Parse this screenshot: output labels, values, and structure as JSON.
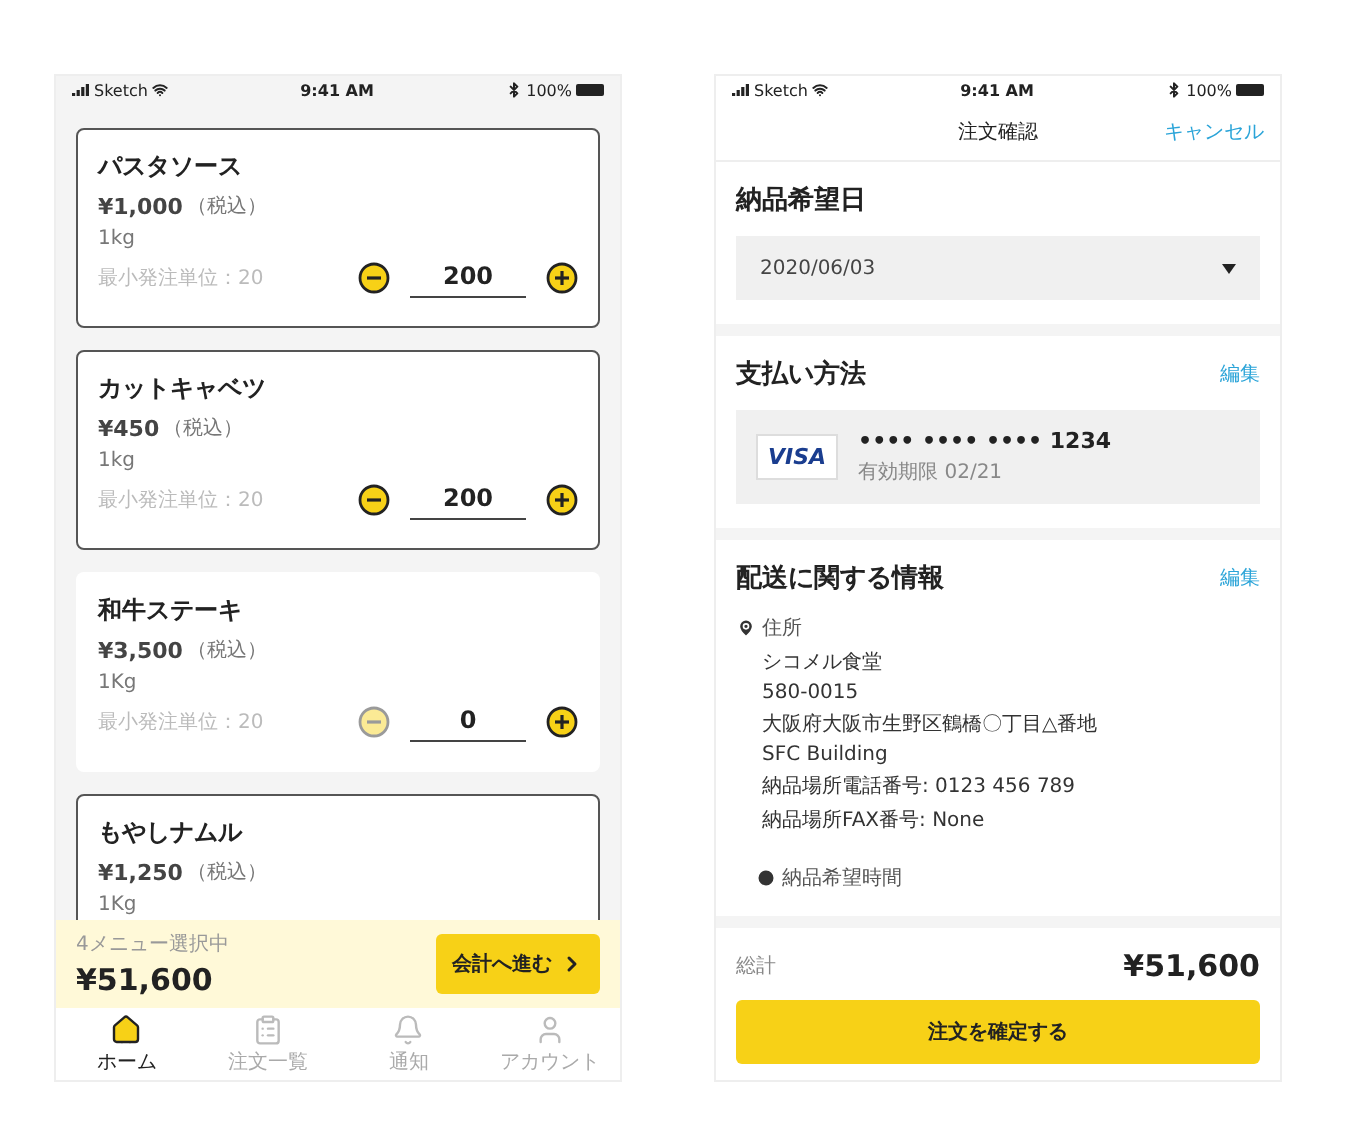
{
  "menu_screen": {
    "status_bar": {
      "carrier": "Sketch",
      "time": "9:41 AM",
      "battery": "100%"
    },
    "items": [
      {
        "name": "パスタソース",
        "price": "¥1,000",
        "tax": "（税込）",
        "unit": "1kg",
        "min_order": "最小発注単位：20",
        "quantity": "200",
        "selected": true,
        "minus_disabled": false
      },
      {
        "name": "カットキャベツ",
        "price": "¥450",
        "tax": "（税込）",
        "unit": "1kg",
        "min_order": "最小発注単位：20",
        "quantity": "200",
        "selected": true,
        "minus_disabled": false
      },
      {
        "name": "和牛ステーキ",
        "price": "¥3,500",
        "tax": "（税込）",
        "unit": "1Kg",
        "min_order": "最小発注単位：20",
        "quantity": "0",
        "selected": false,
        "minus_disabled": true
      },
      {
        "name": "もやしナムル",
        "price": "¥1,250",
        "tax": "（税込）",
        "unit": "1Kg",
        "selected": true
      }
    ],
    "summary": {
      "count_label": "4メニュー選択中",
      "total": "¥51,600",
      "checkout": "会計へ進む"
    },
    "tabs": [
      {
        "label": "ホーム",
        "selected": true
      },
      {
        "label": "注文一覧",
        "selected": false
      },
      {
        "label": "通知",
        "selected": false
      },
      {
        "label": "アカウント",
        "selected": false
      }
    ]
  },
  "confirm_screen": {
    "status_bar": {
      "carrier": "Sketch",
      "time": "9:41 AM",
      "battery": "100%"
    },
    "nav": {
      "title": "注文確認",
      "action": "キャンセル"
    },
    "date": {
      "heading": "納品希望日",
      "value": "2020/06/03"
    },
    "payment": {
      "heading": "支払い方法",
      "edit": "編集",
      "card_brand": "VISA",
      "card_number": "•••• •••• •••• 1234",
      "expiry": "有効期限 02/21"
    },
    "shipping": {
      "heading": "配送に関する情報",
      "edit": "編集",
      "address_label": "住所",
      "address_lines": [
        "シコメル食堂",
        "580-0015",
        "大阪府大阪市生野区鶴橋〇丁目△番地",
        "SFC Building",
        "納品場所電話番号: 0123 456 789",
        "納品場所FAX番号: None"
      ],
      "time_label": "納品希望時間"
    },
    "footer": {
      "total_label": "総計",
      "total": "¥51,600",
      "confirm": "注文を確定する"
    }
  }
}
